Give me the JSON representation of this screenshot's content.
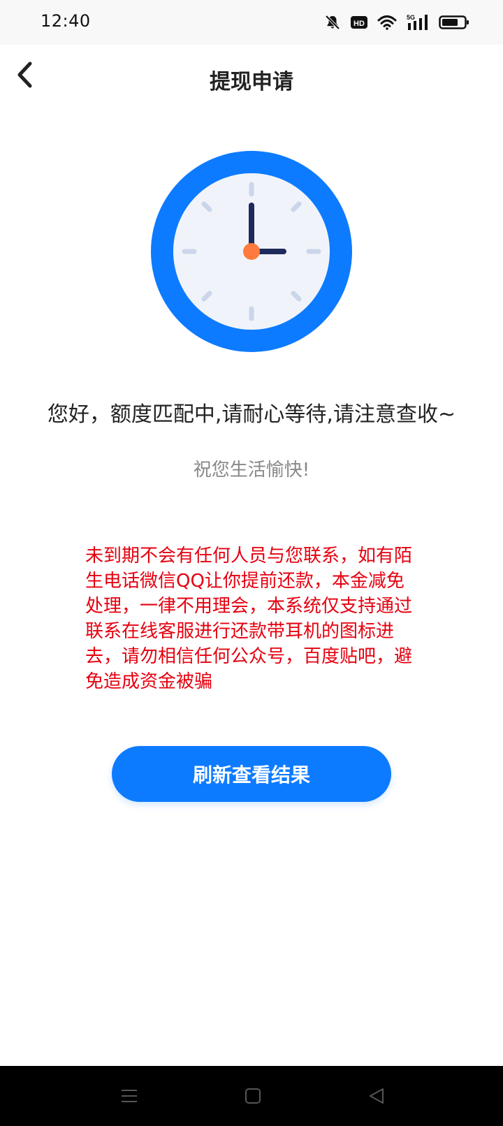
{
  "status_bar": {
    "time": "12:40",
    "icons": [
      "bell-muted-icon",
      "hd-icon",
      "wifi-icon",
      "5g-signal-icon",
      "battery-icon"
    ],
    "hd_label": "HD",
    "network_label": "5G"
  },
  "nav": {
    "title": "提现申请",
    "back_icon": "chevron-left-icon"
  },
  "clock": {
    "icon": "clock-icon",
    "ring_color": "#0d7bff",
    "face_color": "#f0f4fa",
    "hand_color": "#1e2a5c",
    "center_color": "#ff7a3d"
  },
  "content": {
    "main_message": "您好，额度匹配中,请耐心等待,请注意查收~",
    "sub_message": "祝您生活愉快!",
    "warning": "未到期不会有任何人员与您联系，如有陌生电话微信QQ让你提前还款，本金减免处理，一律不用理会，本系统仅支持通过联系在线客服进行还款带耳机的图标进去，请勿相信任何公众号，百度贴吧，避免造成资金被骗",
    "warning_color": "#e5000f",
    "refresh_label": "刷新查看结果",
    "button_color": "#0d7bff"
  },
  "system_nav": {
    "buttons": [
      "menu-icon",
      "home-icon",
      "back-triangle-icon"
    ]
  }
}
